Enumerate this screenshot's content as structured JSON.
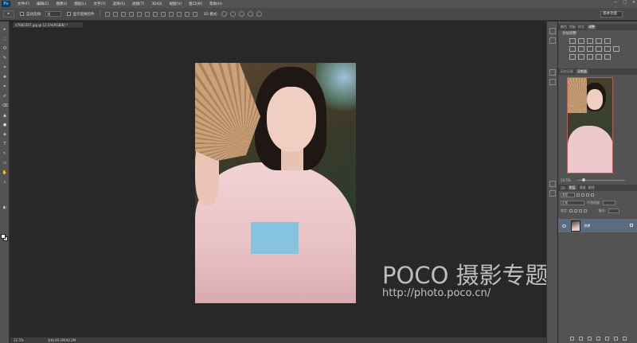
{
  "app": {
    "logo": "Ps"
  },
  "menu": [
    "文件(F)",
    "编辑(E)",
    "图像(I)",
    "图层(L)",
    "文字(Y)",
    "选择(S)",
    "滤镜(T)",
    "3D(D)",
    "视图(V)",
    "窗口(W)",
    "帮助(H)"
  ],
  "window_controls": {
    "minimize": "−",
    "maximize": "□",
    "close": "×"
  },
  "options": {
    "tool": "▸",
    "auto_select_label": "自动选择:",
    "auto_select_value": "组",
    "show_transform_label": "显示变换控件",
    "mode_3d_label": "3D 模式:",
    "workspace": "基本功能"
  },
  "document": {
    "tab_label": "V7682307.jpg @ 12.5%(RGB/8) *",
    "close": "×"
  },
  "toolbox": [
    "▸",
    "⬚",
    "ʘ",
    "✎",
    "⌗",
    "✚",
    "✒",
    "✐",
    "⌫",
    "▲",
    "●",
    "◈",
    "T",
    "↖",
    "▭",
    "✋",
    "⌕",
    "◐"
  ],
  "panels": {
    "top_tabs": [
      "颜色",
      "色板",
      "样式",
      "调整"
    ],
    "adjustments_title": "添加调整",
    "nav_tabs": [
      "历史记录",
      "导航器"
    ],
    "zoom": "12.5%",
    "layer_tabs": [
      "图层",
      "通道",
      "路径"
    ],
    "layer_tabs_prefix": "3D",
    "blend_mode": "正常",
    "opacity_label": "不透明度:",
    "lock_label": "锁定:",
    "fill_label": "填充:",
    "kind_filter": "类型",
    "layer_name": "背景"
  },
  "status": {
    "zoom": "12.5%",
    "doc_size": "文档:40.2M/40.2M"
  },
  "watermark": {
    "logo": "POCO 摄影专题",
    "url": "http://photo.poco.cn/"
  }
}
